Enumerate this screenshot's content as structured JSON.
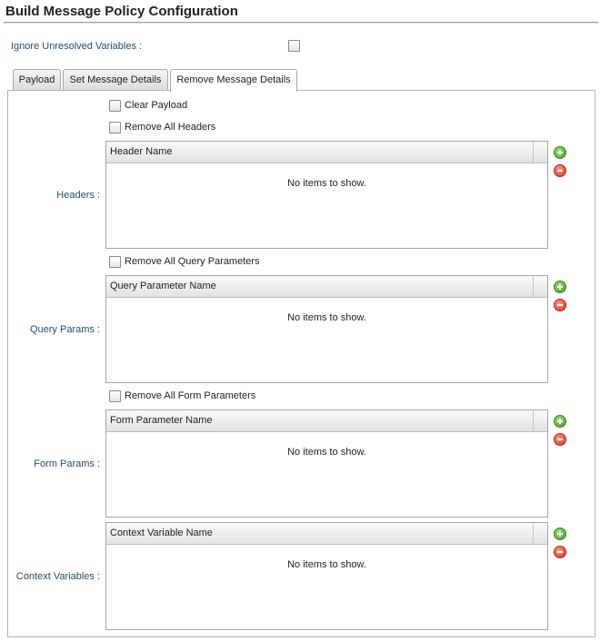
{
  "title": "Build Message Policy Configuration",
  "ignore_unresolved": {
    "label": "Ignore Unresolved Variables :",
    "checked": false
  },
  "tabs": [
    {
      "label": "Payload",
      "active": false
    },
    {
      "label": "Set Message Details",
      "active": false
    },
    {
      "label": "Remove Message Details",
      "active": true
    }
  ],
  "checkboxes": {
    "clear_payload": "Clear Payload",
    "remove_all_headers": "Remove All Headers",
    "remove_all_query": "Remove All Query Parameters",
    "remove_all_form": "Remove All Form Parameters"
  },
  "sections": {
    "headers": {
      "label": "Headers :",
      "column": "Header Name",
      "empty": "No items to show."
    },
    "query": {
      "label": "Query Params :",
      "column": "Query Parameter Name",
      "empty": "No items to show."
    },
    "form": {
      "label": "Form Params :",
      "column": "Form Parameter Name",
      "empty": "No items to show."
    },
    "context": {
      "label": "Context Variables :",
      "column": "Context Variable Name",
      "empty": "No items to show."
    }
  },
  "icons": {
    "add": "add-circle-icon",
    "remove": "remove-circle-icon"
  }
}
